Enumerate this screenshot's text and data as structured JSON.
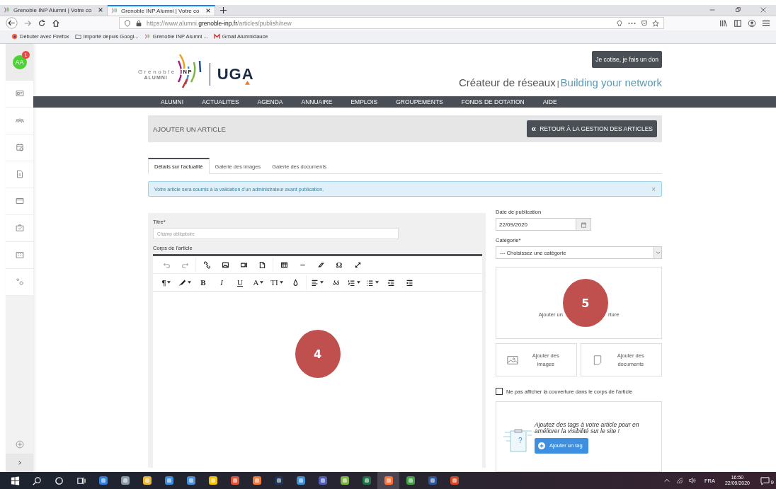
{
  "browser": {
    "tabs": [
      {
        "title": "Grenoble INP Alumni | Votre co",
        "selected": false
      },
      {
        "title": "Grenoble INP Alumni | Votre co",
        "selected": true
      }
    ],
    "url": {
      "prefix": "https://www.alumni.",
      "domain": "grenoble-inp.fr",
      "path": "/articles/publish/new"
    },
    "bookmarks": [
      {
        "kind": "firefox",
        "label": "Débuter avec Firefox"
      },
      {
        "kind": "folder",
        "label": "Importé depuis Googl..."
      },
      {
        "kind": "site",
        "label": "Grenoble INP Alumni ..."
      },
      {
        "kind": "mail",
        "label": "Gmail Alumnidauce"
      }
    ]
  },
  "sidebar": {
    "avatar": "AA",
    "badge": "1"
  },
  "header": {
    "logo": {
      "grenoble": "Grenoble",
      "inp": "INP",
      "alumni": "ALUMNI",
      "uga": "UGA"
    },
    "donate_button": "Je cotise, je fais un don",
    "tagline_fr": "Créateur de réseaux",
    "tagline_sep": "|",
    "tagline_en": "Building your network"
  },
  "menu": [
    "ALUMNI",
    "ACTUALITES",
    "AGENDA",
    "ANNUAIRE",
    "EMPLOIS",
    "GROUPEMENTS",
    "FONDS DE DOTATION",
    "AIDE"
  ],
  "page": {
    "title": "AJOUTER UN ARTICLE",
    "back_button": {
      "icon": "«",
      "label": "RETOUR À LA GESTION DES ARTICLES"
    }
  },
  "tabs": [
    {
      "label": "Détails sur l'actualité",
      "selected": true
    },
    {
      "label": "Galerie des images",
      "selected": false
    },
    {
      "label": "Galerie des documents",
      "selected": false
    }
  ],
  "alert": {
    "text": "Votre article sera soumis à la validation d'un administrateur avant publication.",
    "close": "×"
  },
  "form": {
    "title_label": "Titre*",
    "title_placeholder": "Champ obligatoire",
    "body_label": "Corps de l'article",
    "toolbar": [
      [
        {
          "kind": "undo",
          "disabled": true
        },
        {
          "kind": "redo",
          "disabled": true
        },
        {
          "kind": "sep"
        },
        {
          "kind": "link"
        },
        {
          "kind": "image"
        },
        {
          "kind": "video"
        },
        {
          "kind": "file"
        },
        {
          "kind": "sep"
        },
        {
          "kind": "table"
        },
        {
          "kind": "hr"
        },
        {
          "kind": "eraser"
        },
        {
          "kind": "glyph",
          "glyph": "Ω"
        },
        {
          "kind": "fullscreen"
        }
      ],
      [
        {
          "kind": "glyph",
          "glyph": "¶",
          "dropdown": true
        },
        {
          "kind": "brush",
          "dropdown": true
        },
        {
          "kind": "glyph",
          "glyph": "B"
        },
        {
          "kind": "glyph",
          "glyph": "I"
        },
        {
          "kind": "glyph",
          "glyph": "U"
        },
        {
          "kind": "glyph",
          "glyph": "A",
          "dropdown": true
        },
        {
          "kind": "glyph",
          "glyph": "TI",
          "dropdown": true
        },
        {
          "kind": "drop"
        },
        {
          "kind": "sep"
        },
        {
          "kind": "align",
          "dropdown": true
        },
        {
          "kind": "quote"
        },
        {
          "kind": "ol",
          "dropdown": true
        },
        {
          "kind": "ul",
          "dropdown": true
        },
        {
          "kind": "outdent"
        },
        {
          "kind": "indent"
        }
      ]
    ]
  },
  "side": {
    "date_label": "Date de publication",
    "date_value": "22/09/2020",
    "category_label": "Catégorie*",
    "category_value": "--- Choisissez une catégorie",
    "cover_start": "Ajouter un",
    "cover_end": "rture",
    "add_images": "Ajouter des images",
    "add_documents": "Ajouter des documents",
    "hide_cover_label": "Ne pas afficher la couverture dans le corps de l'article",
    "hide_cover_checked": false,
    "tags_text": "Ajoutez des tags à votre article pour en améliorer la visibilité sur le site !",
    "tags_question": "?",
    "add_tag_button": "Ajouter un tag"
  },
  "annotations": [
    {
      "label": "4"
    },
    {
      "label": "5"
    }
  ],
  "taskbar": {
    "language": "FRA",
    "time": "16:50",
    "date": "22/09/2020",
    "notifications": "9"
  }
}
